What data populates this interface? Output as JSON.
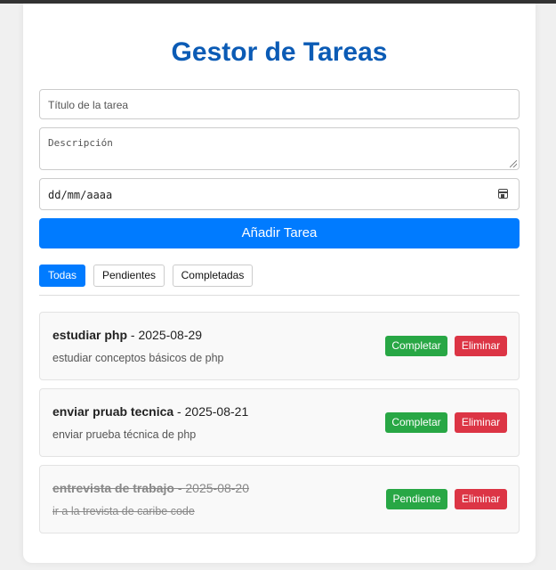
{
  "app": {
    "title": "Gestor de Tareas"
  },
  "form": {
    "title_placeholder": "Título de la tarea",
    "description_placeholder": "Descripción",
    "date_placeholder": "dd/mm/aaaa",
    "add_button_label": "Añadir Tarea"
  },
  "filters": [
    {
      "label": "Todas",
      "active": true
    },
    {
      "label": "Pendientes",
      "active": false
    },
    {
      "label": "Completadas",
      "active": false
    }
  ],
  "tasks": [
    {
      "title": "estudiar php",
      "separator": " - ",
      "date": "2025-08-29",
      "description": "estudiar conceptos básicos de php",
      "status_button": "Completar",
      "delete_button": "Eliminar",
      "completed": false
    },
    {
      "title": "enviar pruab tecnica",
      "separator": " - ",
      "date": "2025-08-21",
      "description": "enviar prueba técnica de php",
      "status_button": "Completar",
      "delete_button": "Eliminar",
      "completed": false
    },
    {
      "title": "entrevista de trabajo",
      "separator": " - ",
      "date": "2025-08-20",
      "description": "ir a la trevista de caribe code",
      "status_button": "Pendiente",
      "delete_button": "Eliminar",
      "completed": true
    }
  ],
  "colors": {
    "title": "#0b5bb5",
    "primary": "#007bff",
    "success": "#28a745",
    "danger": "#dc3545"
  }
}
